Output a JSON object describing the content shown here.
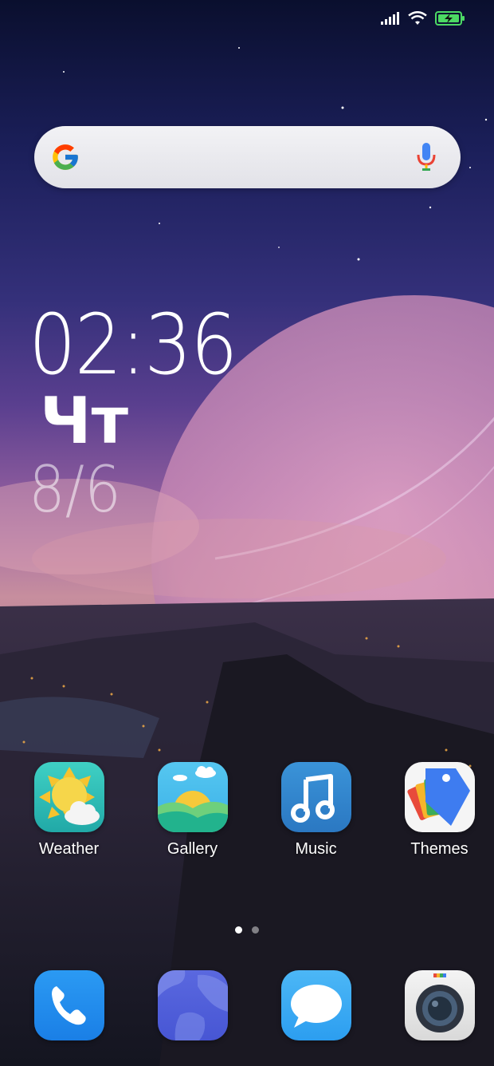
{
  "status_bar": {
    "signal_icon": "cellular-signal-icon",
    "wifi_icon": "wifi-icon",
    "battery_icon": "battery-charging-icon",
    "battery_color": "#4cd964"
  },
  "search": {
    "logo_icon": "google-g-icon",
    "mic_icon": "microphone-icon"
  },
  "clock": {
    "time": "02:36",
    "day": "Чт",
    "date": "8/6"
  },
  "apps": [
    {
      "label": "Weather",
      "icon": "weather-icon"
    },
    {
      "label": "Gallery",
      "icon": "gallery-icon"
    },
    {
      "label": "Music",
      "icon": "music-icon"
    },
    {
      "label": "Themes",
      "icon": "themes-icon"
    }
  ],
  "pager": {
    "pages": 2,
    "current": 1
  },
  "dock": [
    {
      "icon": "phone-icon"
    },
    {
      "icon": "browser-icon"
    },
    {
      "icon": "messages-icon"
    },
    {
      "icon": "camera-icon"
    }
  ]
}
